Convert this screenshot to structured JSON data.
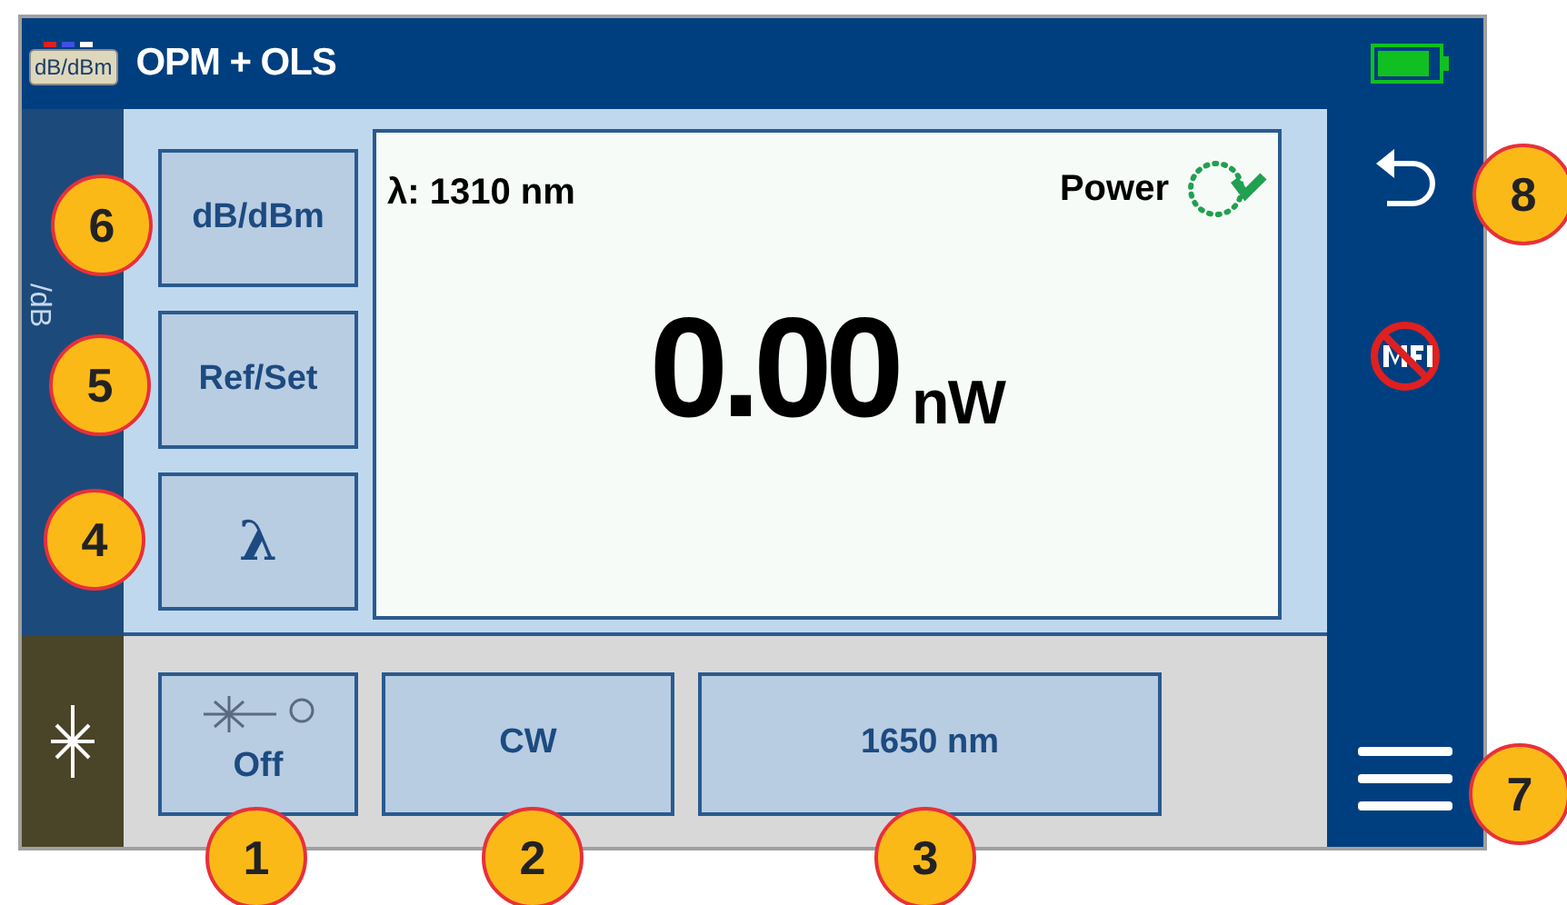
{
  "title_bar": {
    "badge": "dB/dBm",
    "title": "OPM + OLS"
  },
  "side_tab": {
    "label": "/dB"
  },
  "left_buttons": [
    {
      "label": "dB/dBm"
    },
    {
      "label": "Ref/Set"
    },
    {
      "label": "λ"
    }
  ],
  "display": {
    "wavelength": "λ: 1310 nm",
    "mode": "Power",
    "value": "0.00",
    "unit": "nW"
  },
  "source_buttons": [
    {
      "kind": "toggle",
      "label": "Off"
    },
    {
      "kind": "text",
      "label": "CW"
    },
    {
      "kind": "text",
      "label": "1650 nm"
    }
  ],
  "callouts": [
    "8",
    "6",
    "5",
    "4",
    "7",
    "1",
    "2",
    "3"
  ]
}
